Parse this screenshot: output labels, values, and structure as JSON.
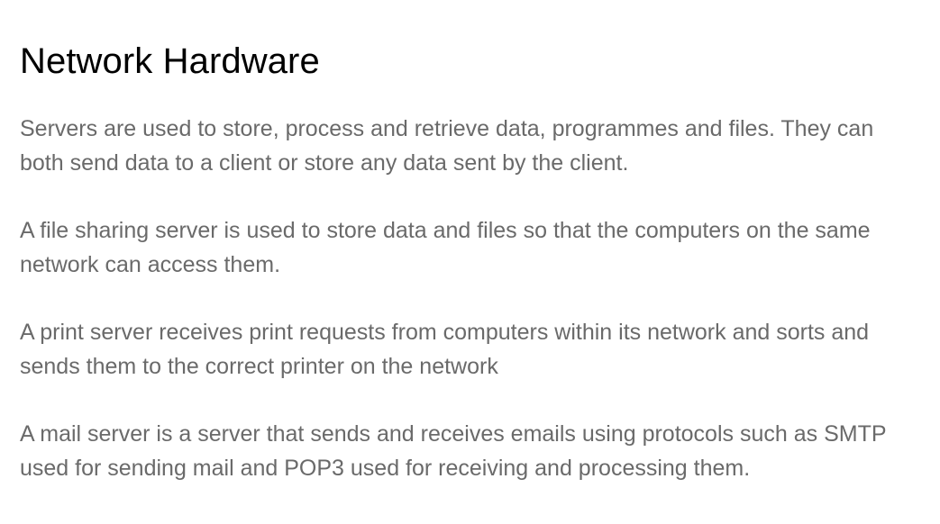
{
  "page": {
    "title": "Network Hardware",
    "paragraphs": [
      "Servers are used to store, process and retrieve data, programmes and files. They can both send data to a client or store any data sent by the client.",
      "A file sharing server is used to store data and files so that the computers on the same network can access them.",
      "A print server receives print requests from computers within its network and sorts and sends them to the correct printer on the network",
      "A mail server is a server that sends and receives emails using protocols such as SMTP used for sending mail and POP3 used for receiving and processing them."
    ]
  },
  "colors": {
    "title": "#000000",
    "body_text": "#6a6a6a",
    "background": "#ffffff"
  }
}
